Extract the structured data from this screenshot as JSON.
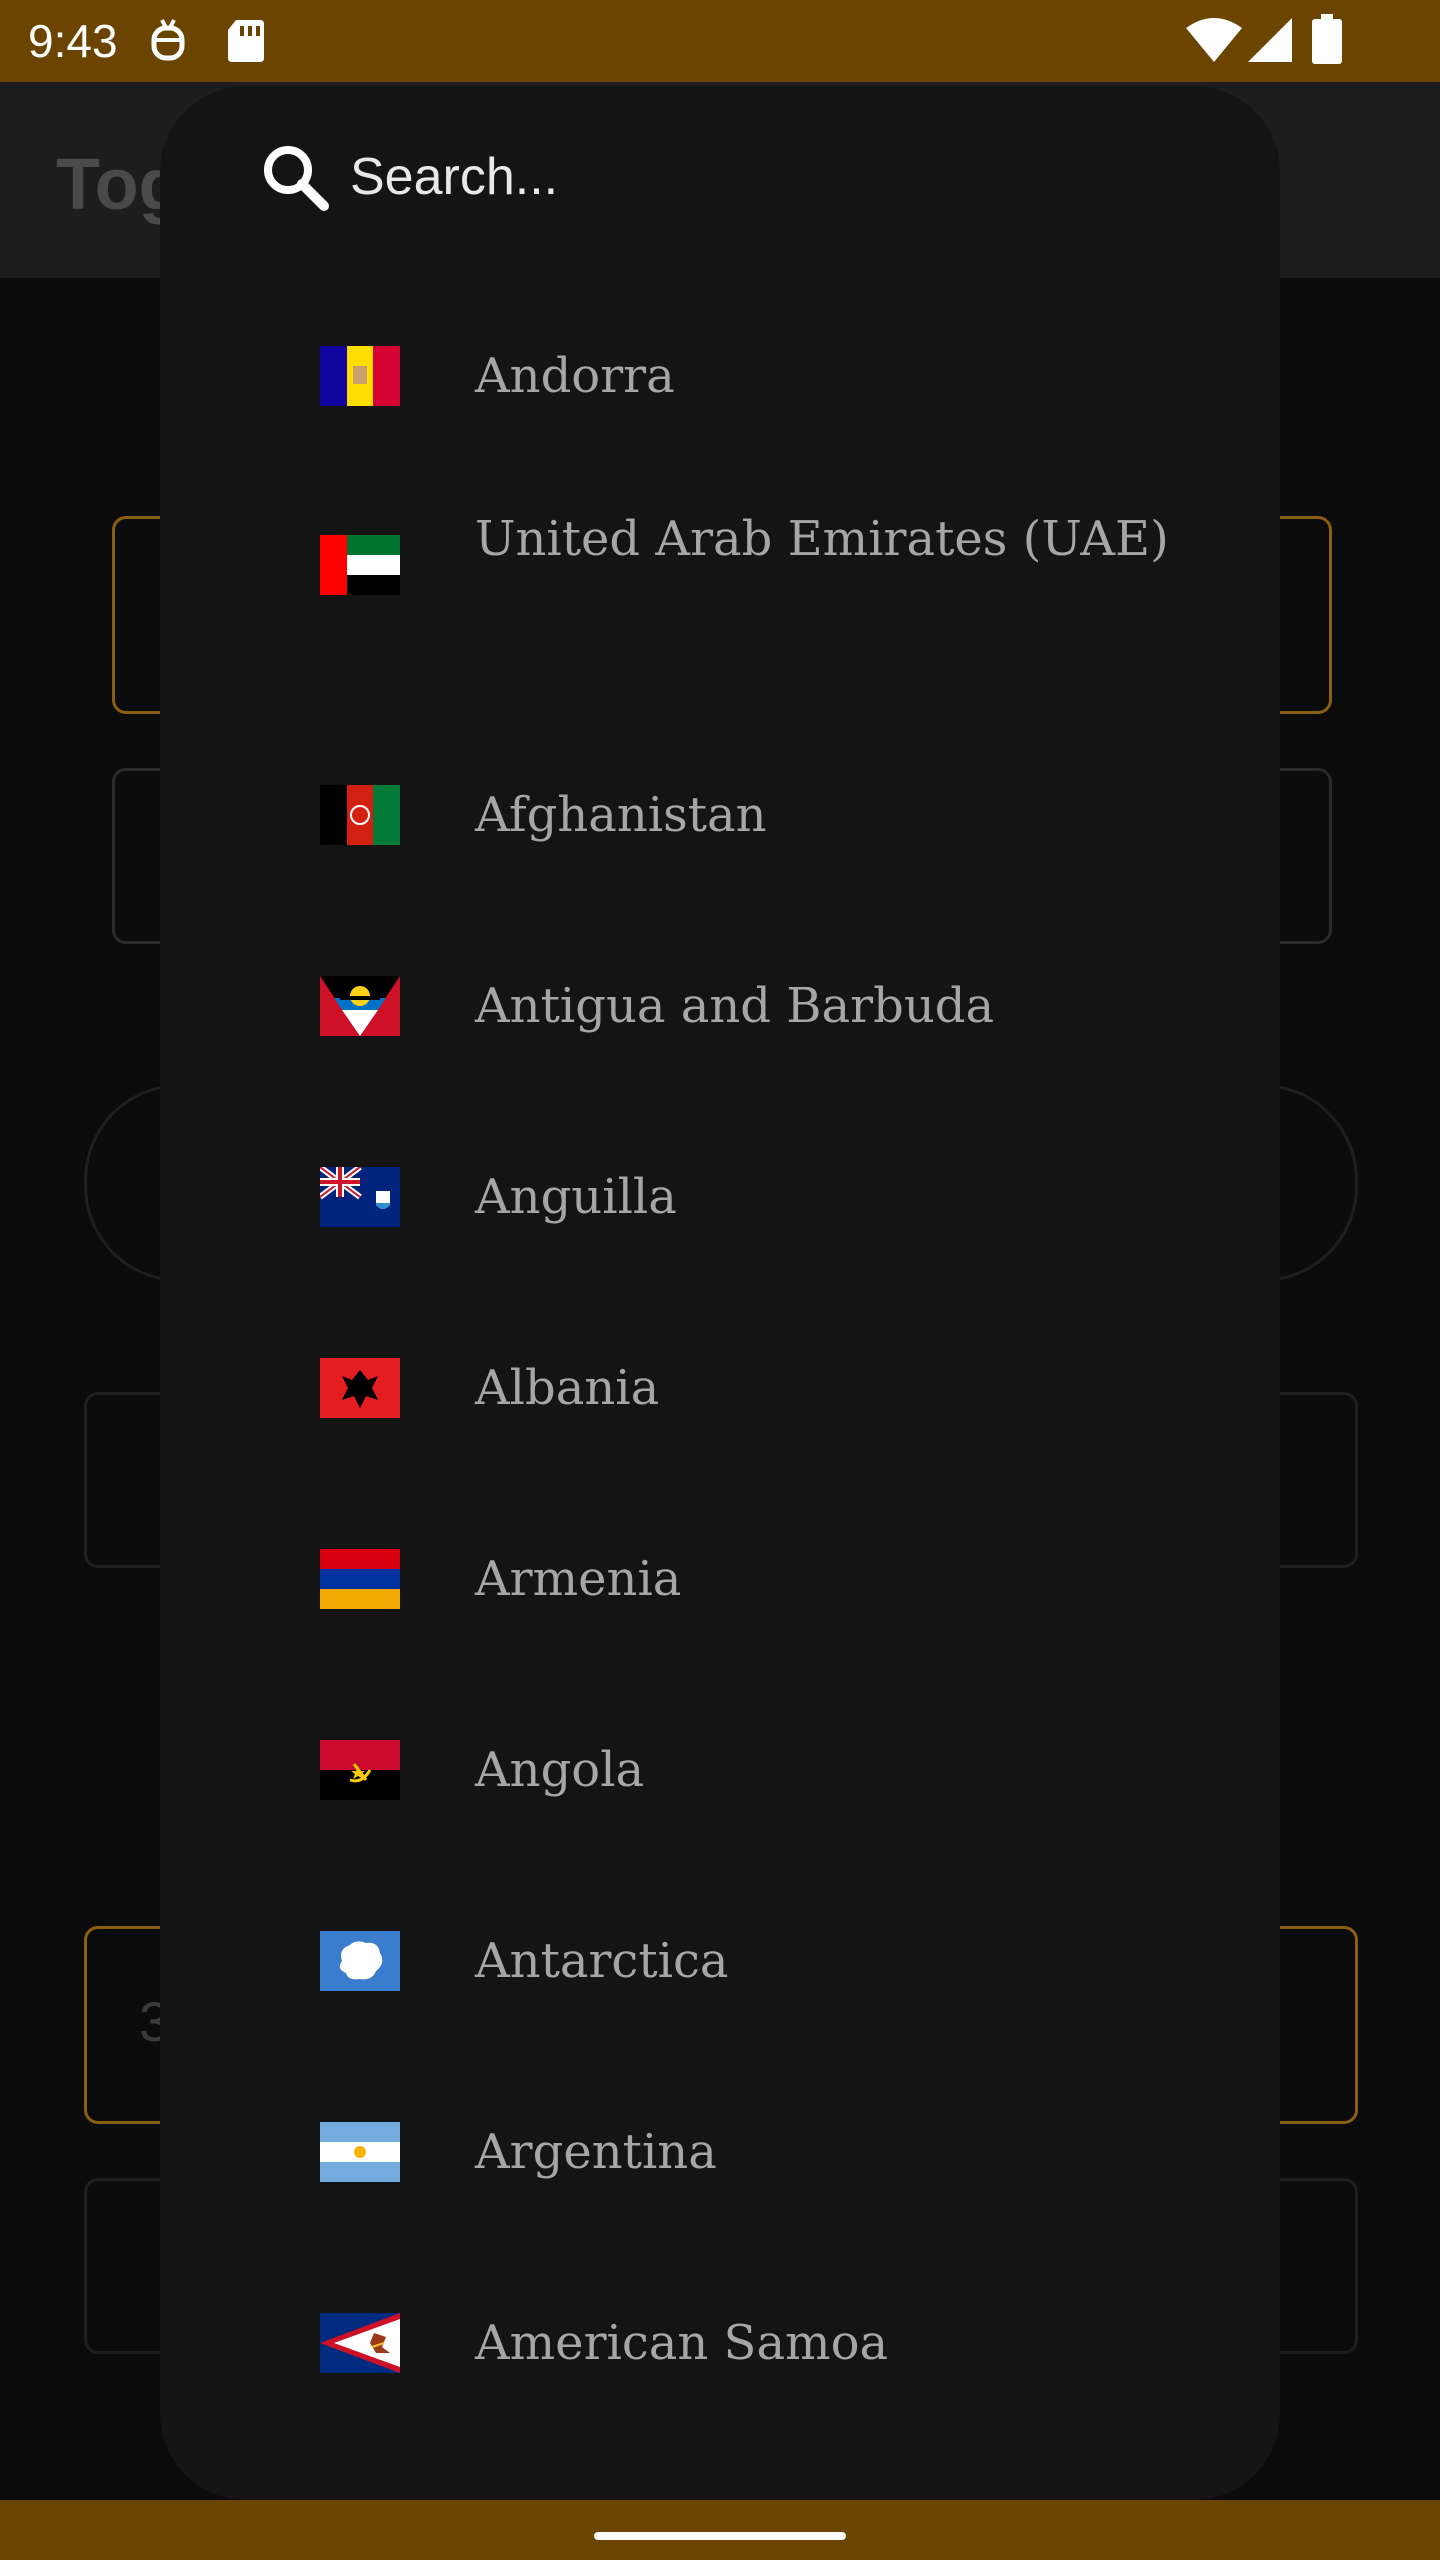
{
  "status_bar": {
    "time": "9:43"
  },
  "background_app": {
    "title": "Tog",
    "field_value": "3"
  },
  "dialog": {
    "search_placeholder": "Search...",
    "countries": [
      {
        "name": "Andorra",
        "flag": "andorra-flag-icon"
      },
      {
        "name": "United Arab Emirates (UAE)",
        "flag": "uae-flag-icon"
      },
      {
        "name": "Afghanistan",
        "flag": "afghanistan-flag-icon"
      },
      {
        "name": "Antigua and Barbuda",
        "flag": "antigua-flag-icon"
      },
      {
        "name": "Anguilla",
        "flag": "anguilla-flag-icon"
      },
      {
        "name": "Albania",
        "flag": "albania-flag-icon"
      },
      {
        "name": "Armenia",
        "flag": "armenia-flag-icon"
      },
      {
        "name": "Angola",
        "flag": "angola-flag-icon"
      },
      {
        "name": "Antarctica",
        "flag": "antarctica-flag-icon"
      },
      {
        "name": "Argentina",
        "flag": "argentina-flag-icon"
      },
      {
        "name": "American Samoa",
        "flag": "american-samoa-flag-icon"
      }
    ]
  },
  "colors": {
    "status_bar": "#6b4500",
    "dialog_bg": "#141414",
    "item_text": "#a6a6a6",
    "accent_border": "#b07a12"
  }
}
